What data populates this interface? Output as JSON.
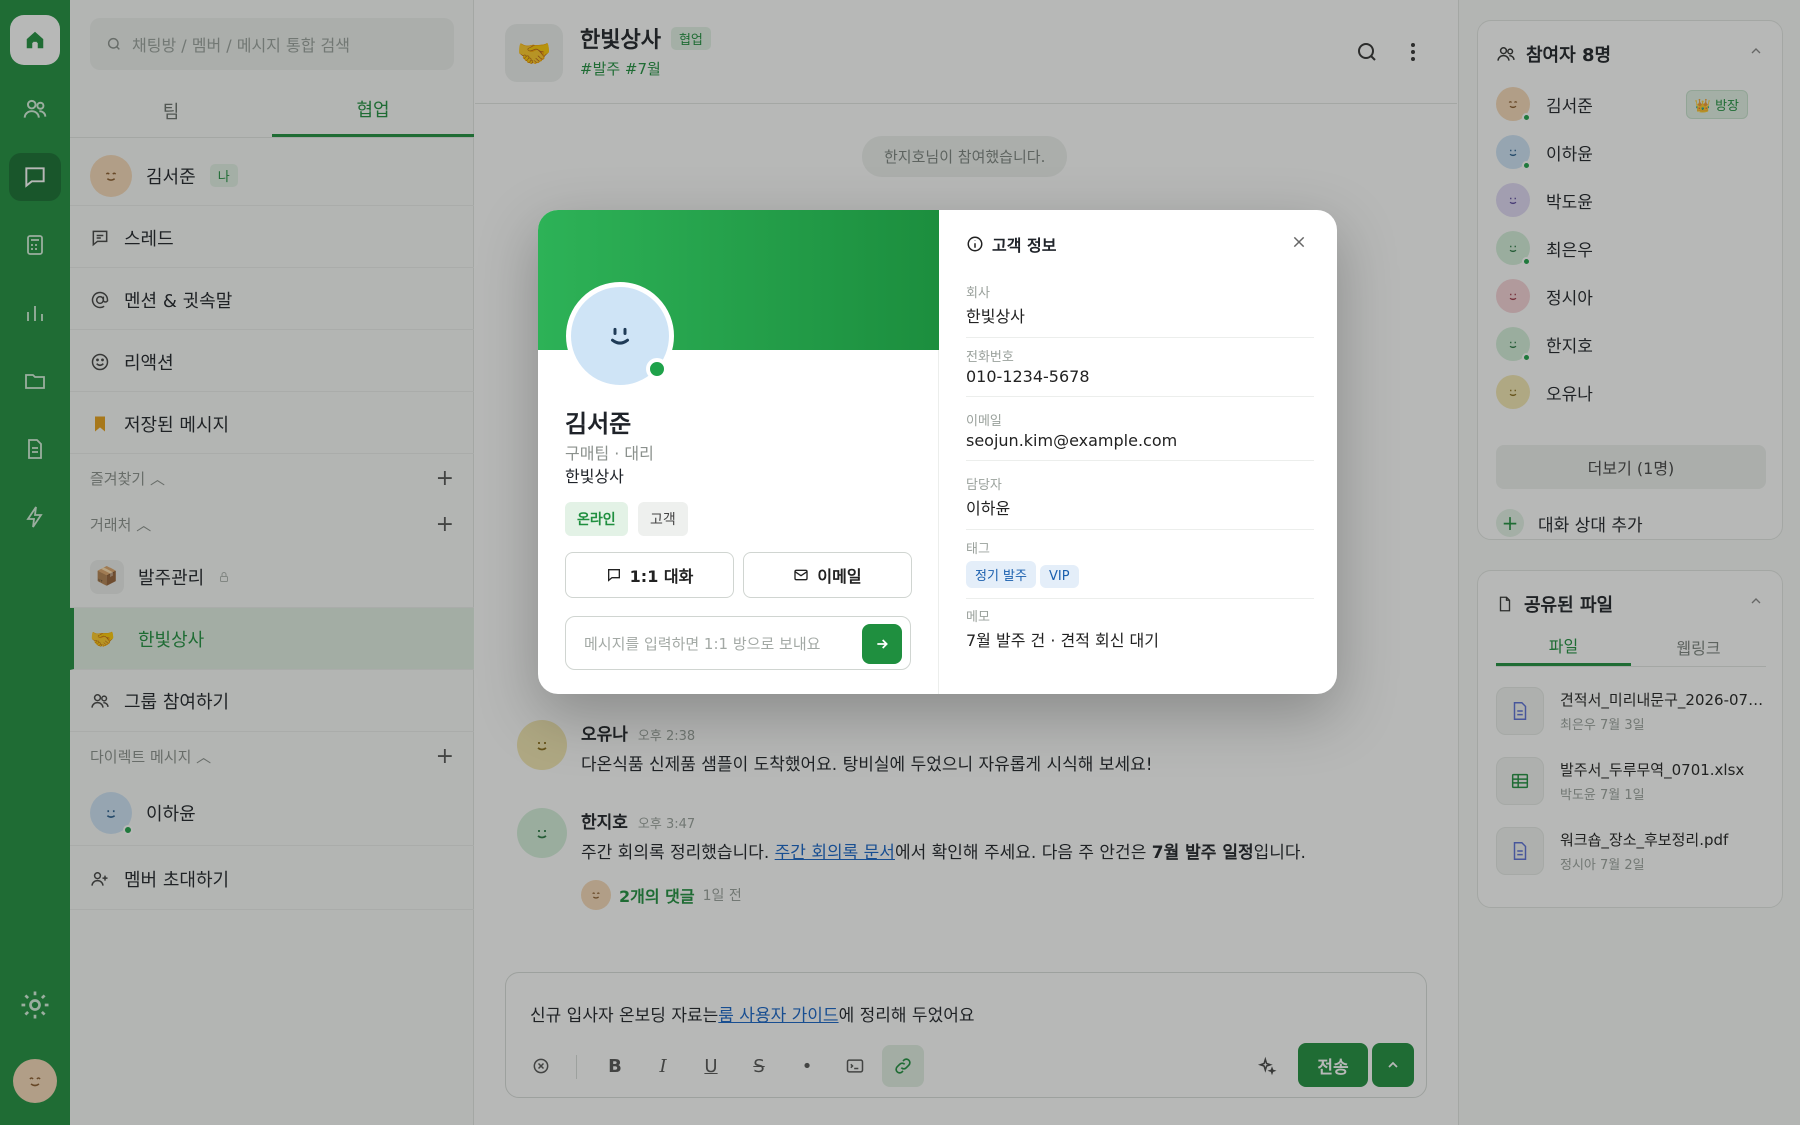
{
  "sidebar": {
    "search_placeholder": "채팅방 / 멤버 / 메시지 통합 검색",
    "tabs": [
      "팀",
      "협업"
    ],
    "me": {
      "name": "김서준",
      "badge": "나"
    },
    "menu": [
      "스레드",
      "멘션 & 귓속말",
      "리액션",
      "저장된 메시지"
    ],
    "favorites_label": "즐겨찾기",
    "clients_label": "거래처",
    "channels": [
      {
        "name": "발주관리",
        "icon": "📦"
      },
      {
        "name": "한빛상사",
        "icon": "🤝"
      },
      {
        "name": "그룹 참여하기"
      }
    ],
    "dm_label": "다이렉트 메시지",
    "dms": [
      {
        "name": "이하윤"
      }
    ],
    "invite_label": "멤버 초대하기"
  },
  "channel": {
    "icon": "🤝",
    "title": "한빛상사",
    "badge": "협업",
    "tags": "#발주 #7월",
    "join_notice": "한지호님이 참여했습니다."
  },
  "messages": [
    {
      "name": "오유나",
      "time": "오후 2:38",
      "text": "다온식품 신제품 샘플이 도착했어요. 탕비실에 두었으니 자유롭게 시식해 보세요!"
    },
    {
      "name": "한지호",
      "time": "오후 3:47",
      "text_a": "주간 회의록 정리했습니다. ",
      "link": "주간 회의록 문서",
      "text_b": "에서 확인해 주세요. 다음 주 안건은 ",
      "bold": "7월 발주 일정",
      "text_c": "입니다.",
      "replies": "2개의 댓글",
      "replies_time": "1일 전"
    }
  ],
  "composer": {
    "text_a": "신규 입사자 온보딩 자료는",
    "link": "룸 사용자 가이드",
    "text_b": "에 정리해 두었어요",
    "send": "전송"
  },
  "participants": {
    "title": "참여자 8명",
    "owner_badge": "👑 방장",
    "list": [
      "김서준",
      "이하윤",
      "박도윤",
      "최은우",
      "정시아",
      "한지호",
      "오유나"
    ],
    "more": "더보기 (1명)",
    "add": "대화 상대 추가"
  },
  "files": {
    "title": "공유된 파일",
    "tabs": [
      "파일",
      "웹링크"
    ],
    "list": [
      {
        "name": "견적서_미리내문구_2026-07.pdf",
        "meta": "최은우  7월 3일"
      },
      {
        "name": "발주서_두루무역_0701.xlsx",
        "meta": "박도윤  7월 1일"
      },
      {
        "name": "워크숍_장소_후보정리.pdf",
        "meta": "정시아  7월 2일"
      }
    ]
  },
  "profile": {
    "name": "김서준",
    "role": "구매팀 · 대리",
    "company": "한빛상사",
    "chips": [
      "온라인",
      "고객"
    ],
    "btn_chat": "1:1 대화",
    "btn_email": "이메일",
    "input_placeholder": "메시지를 입력하면 1:1 방으로 보내요",
    "info_title": "고객 정보",
    "fields": [
      {
        "label": "회사",
        "value": "한빛상사"
      },
      {
        "label": "전화번호",
        "value": "010-1234-5678"
      },
      {
        "label": "이메일",
        "value": "seojun.kim@example.com"
      },
      {
        "label": "담당자",
        "value": "이하윤"
      },
      {
        "label": "태그",
        "value": ""
      },
      {
        "label": "메모",
        "value": "7월 발주 건 · 견적 회신 대기"
      }
    ],
    "tags": [
      "정기 발주",
      "VIP"
    ]
  },
  "colors": {
    "brand": "#1f8f3f",
    "link": "#1663c7"
  }
}
